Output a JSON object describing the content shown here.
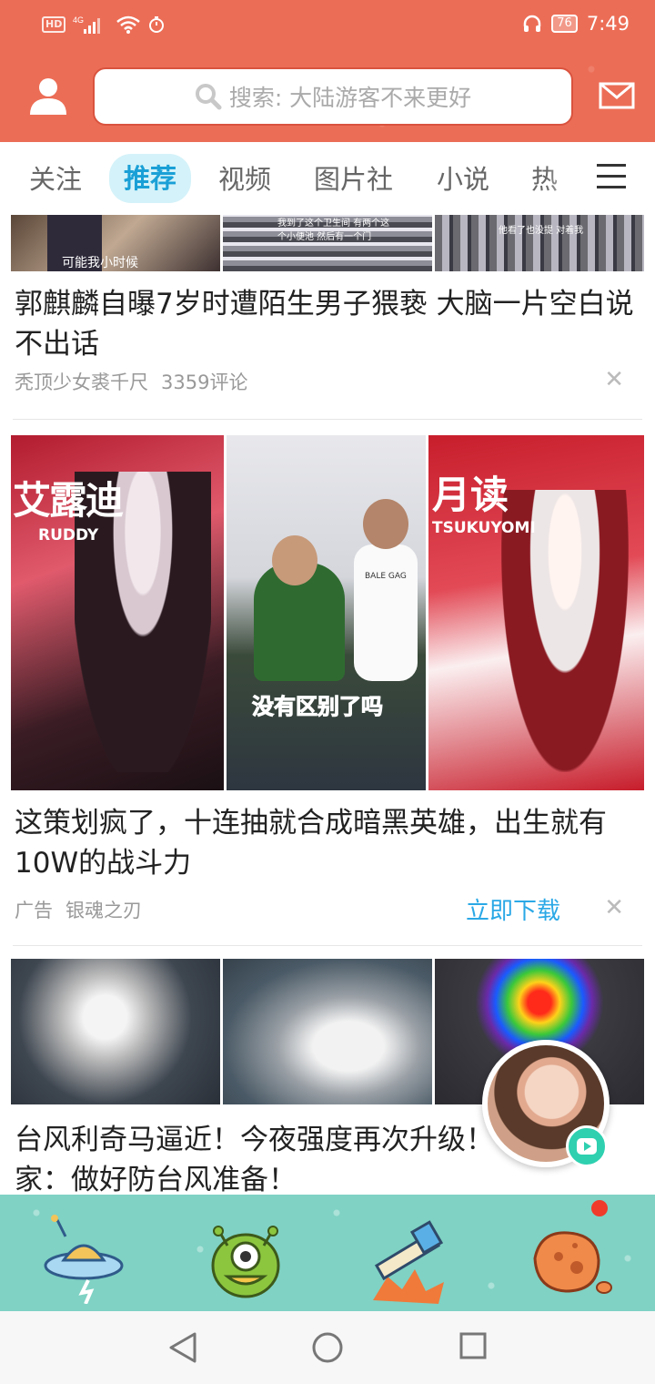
{
  "status_bar": {
    "network": "HD 4G",
    "battery": "76",
    "time": "7:49"
  },
  "header": {
    "search_placeholder": "搜索: 大陆游客不来更好"
  },
  "tabs": [
    {
      "label": "关注",
      "active": false
    },
    {
      "label": "推荐",
      "active": true
    },
    {
      "label": "视频",
      "active": false
    },
    {
      "label": "图片社",
      "active": false
    },
    {
      "label": "小说",
      "active": false
    },
    {
      "label": "热",
      "active": false
    }
  ],
  "feed": {
    "item1": {
      "thumb_captions": [
        "可能我小时候",
        "我到了这个卫生间 有两个这个小便池 然后有一个门",
        "他看了也没提 对着我"
      ],
      "title": "郭麒麟自曝7岁时遭陌生男子猥亵 大脑一片空白说不出话",
      "source": "秃顶少女裘千尺",
      "comments": "3359评论"
    },
    "item2": {
      "images": [
        {
          "text": "艾露迪",
          "sub": "RUDDY"
        },
        {
          "text": "没有区别了吗",
          "shirt": "BALE GAG"
        },
        {
          "text": "月读",
          "sub": "TSUKUYOMI"
        }
      ],
      "title": "这策划疯了，十连抽就合成暗黑英雄，出生就有10W的战斗力",
      "ad_label": "广告",
      "source": "银魂之刃",
      "cta": "立即下载"
    },
    "item3": {
      "title": "台风利奇马逼近！今夜强度再次升级！专家：做好防台风准备！"
    }
  },
  "colors": {
    "brand": "#ec6d56",
    "accent": "#1aa0d6",
    "nav_bg": "#7fd2c4"
  },
  "bottom_nav": [
    "ufo-icon",
    "green-monster-icon",
    "telescope-icon",
    "planet-icon"
  ]
}
